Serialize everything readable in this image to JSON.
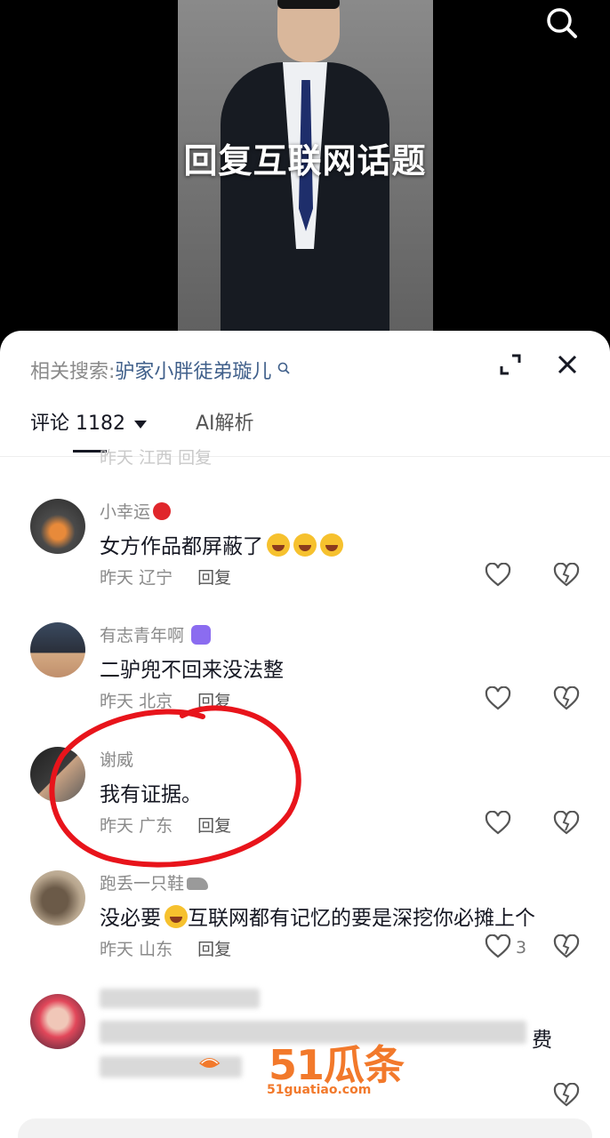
{
  "video": {
    "title": "回复互联网话题"
  },
  "sheet": {
    "related_label": "相关搜索:",
    "related_keyword": "驴家小胖徒弟璇儿",
    "tabs": {
      "comments": "评论 1182",
      "ai": "AI解析"
    }
  },
  "cut_row": {
    "text": "昨天 江西    回复"
  },
  "comments": [
    {
      "name": "小幸运",
      "text": "女方作品都屏蔽了",
      "time": "昨天",
      "region": "辽宁",
      "reply": "回复",
      "likes": ""
    },
    {
      "name": "有志青年啊",
      "text": "二驴兜不回来没法整",
      "time": "昨天",
      "region": "北京",
      "reply": "回复",
      "likes": ""
    },
    {
      "name": "谢威",
      "text": "我有证据。",
      "time": "昨天",
      "region": "广东",
      "reply": "回复",
      "likes": ""
    },
    {
      "name": "跑丢一只鞋",
      "text_before": "没必要",
      "text_after": "互联网都有记忆的要是深挖你必摊上个",
      "time": "昨天",
      "region": "山东",
      "reply": "回复",
      "likes": "3"
    }
  ],
  "blurred_comment": {
    "visible_tail": "费"
  },
  "watermark": {
    "brand": "51瓜条",
    "domain": "51guatiao.com"
  },
  "colors": {
    "annotation": "#e8141b",
    "link": "#3f5f8a",
    "watermark": "#f2792b"
  },
  "icons": [
    "search-icon",
    "expand-icon",
    "close-icon",
    "heart-icon",
    "broken-heart-icon",
    "chevron-down-icon"
  ]
}
